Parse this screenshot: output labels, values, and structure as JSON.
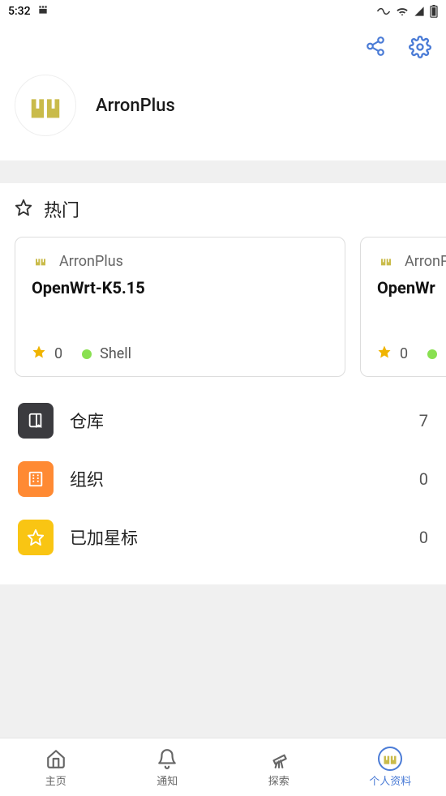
{
  "status": {
    "time": "5:32"
  },
  "profile": {
    "username": "ArronPlus"
  },
  "popular": {
    "title": "热门",
    "repos": [
      {
        "owner": "ArronPlus",
        "name": "OpenWrt-K5.15",
        "stars": 0,
        "lang": "Shell",
        "langColor": "#89e051"
      },
      {
        "owner": "ArronPlus",
        "name": "OpenWr",
        "stars": 0,
        "lang": "",
        "langColor": "#89e051"
      }
    ]
  },
  "menu": {
    "items": [
      {
        "key": "repos",
        "label": "仓库",
        "count": 7,
        "bg": "#3b3b3f",
        "icon": "repo"
      },
      {
        "key": "orgs",
        "label": "组织",
        "count": 0,
        "bg": "#ff8a33",
        "icon": "org"
      },
      {
        "key": "starred",
        "label": "已加星标",
        "count": 0,
        "bg": "#f9c513",
        "icon": "star"
      }
    ]
  },
  "nav": {
    "items": [
      {
        "key": "home",
        "label": "主页"
      },
      {
        "key": "notify",
        "label": "通知"
      },
      {
        "key": "explore",
        "label": "探索"
      },
      {
        "key": "profile",
        "label": "个人资料"
      }
    ]
  }
}
